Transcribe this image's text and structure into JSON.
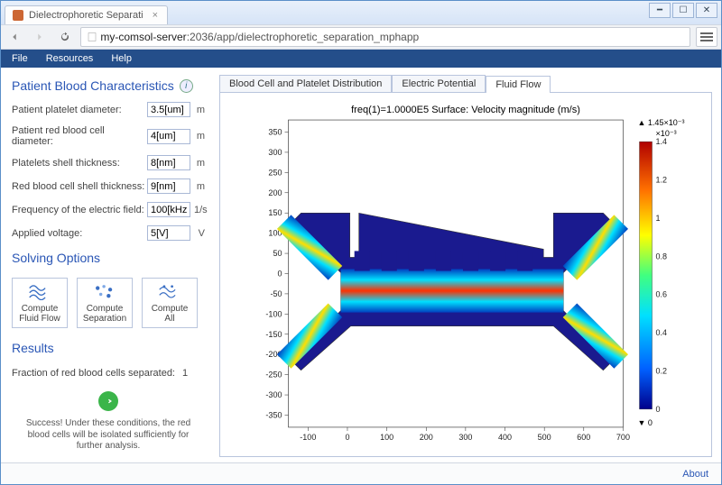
{
  "window": {
    "tab_title": "Dielectrophoretic Separati",
    "url_host": "my-comsol-server",
    "url_rest": ":2036/app/dielectrophoretic_separation_mphapp"
  },
  "menubar": [
    "File",
    "Resources",
    "Help"
  ],
  "sidebar": {
    "section_chars": "Patient Blood Characteristics",
    "fields": [
      {
        "label": "Patient platelet diameter:",
        "value": "3.5[um]",
        "unit": "m"
      },
      {
        "label": "Patient red blood cell diameter:",
        "value": "4[um]",
        "unit": "m"
      },
      {
        "label": "Platelets shell thickness:",
        "value": "8[nm]",
        "unit": "m"
      },
      {
        "label": "Red blood cell shell thickness:",
        "value": "9[nm]",
        "unit": "m"
      },
      {
        "label": "Frequency of the electric field:",
        "value": "100[kHz]",
        "unit": "1/s"
      },
      {
        "label": "Applied voltage:",
        "value": "5[V]",
        "unit": "V"
      }
    ],
    "section_solve": "Solving Options",
    "buttons": [
      {
        "label": "Compute\nFluid Flow"
      },
      {
        "label": "Compute\nSeparation"
      },
      {
        "label": "Compute\nAll"
      }
    ],
    "section_results": "Results",
    "result_label": "Fraction of red blood cells separated:",
    "result_value": "1",
    "success_text": "Success! Under these conditions, the red blood cells will be isolated sufficiently for further analysis."
  },
  "tabs": [
    "Blood Cell and Platelet Distribution",
    "Electric Potential",
    "Fluid Flow"
  ],
  "active_tab": 2,
  "plot": {
    "title": "freq(1)=1.0000E5   Surface: Velocity magnitude (m/s)",
    "x_ticks": [
      -100,
      0,
      100,
      200,
      300,
      400,
      500,
      600,
      700
    ],
    "y_ticks": [
      -350,
      -300,
      -250,
      -200,
      -150,
      -100,
      -50,
      0,
      50,
      100,
      150,
      200,
      250,
      300,
      350
    ],
    "colorbar_max_label": "▲ 1.45×10⁻³",
    "colorbar_exp": "×10⁻³",
    "colorbar_ticks": [
      "1.4",
      "1.2",
      "1",
      "0.8",
      "0.6",
      "0.4",
      "0.2",
      "0"
    ],
    "colorbar_min_label": "▼ 0"
  },
  "footer": {
    "about": "About"
  },
  "chart_data": {
    "type": "heatmap",
    "title": "freq(1)=1.0000E5   Surface: Velocity magnitude (m/s)",
    "xlabel": "",
    "ylabel": "",
    "xlim": [
      -150,
      700
    ],
    "ylim": [
      -380,
      380
    ],
    "color_variable": "Velocity magnitude (m/s)",
    "color_range": [
      0,
      0.00145
    ],
    "color_ticks_e3": [
      0,
      0.2,
      0.4,
      0.6,
      0.8,
      1.0,
      1.2,
      1.4
    ],
    "notes": "Microfluidic Y-channel: two angled inlets merge near x≈0, a straight horizontal channel with seven top electrodes runs to x≈500, then splits into two angled outlets. Highest velocity (red, ≈1.4e-3 m/s) along the channel centerline; surrounding domain ≈0 (dark blue)."
  }
}
